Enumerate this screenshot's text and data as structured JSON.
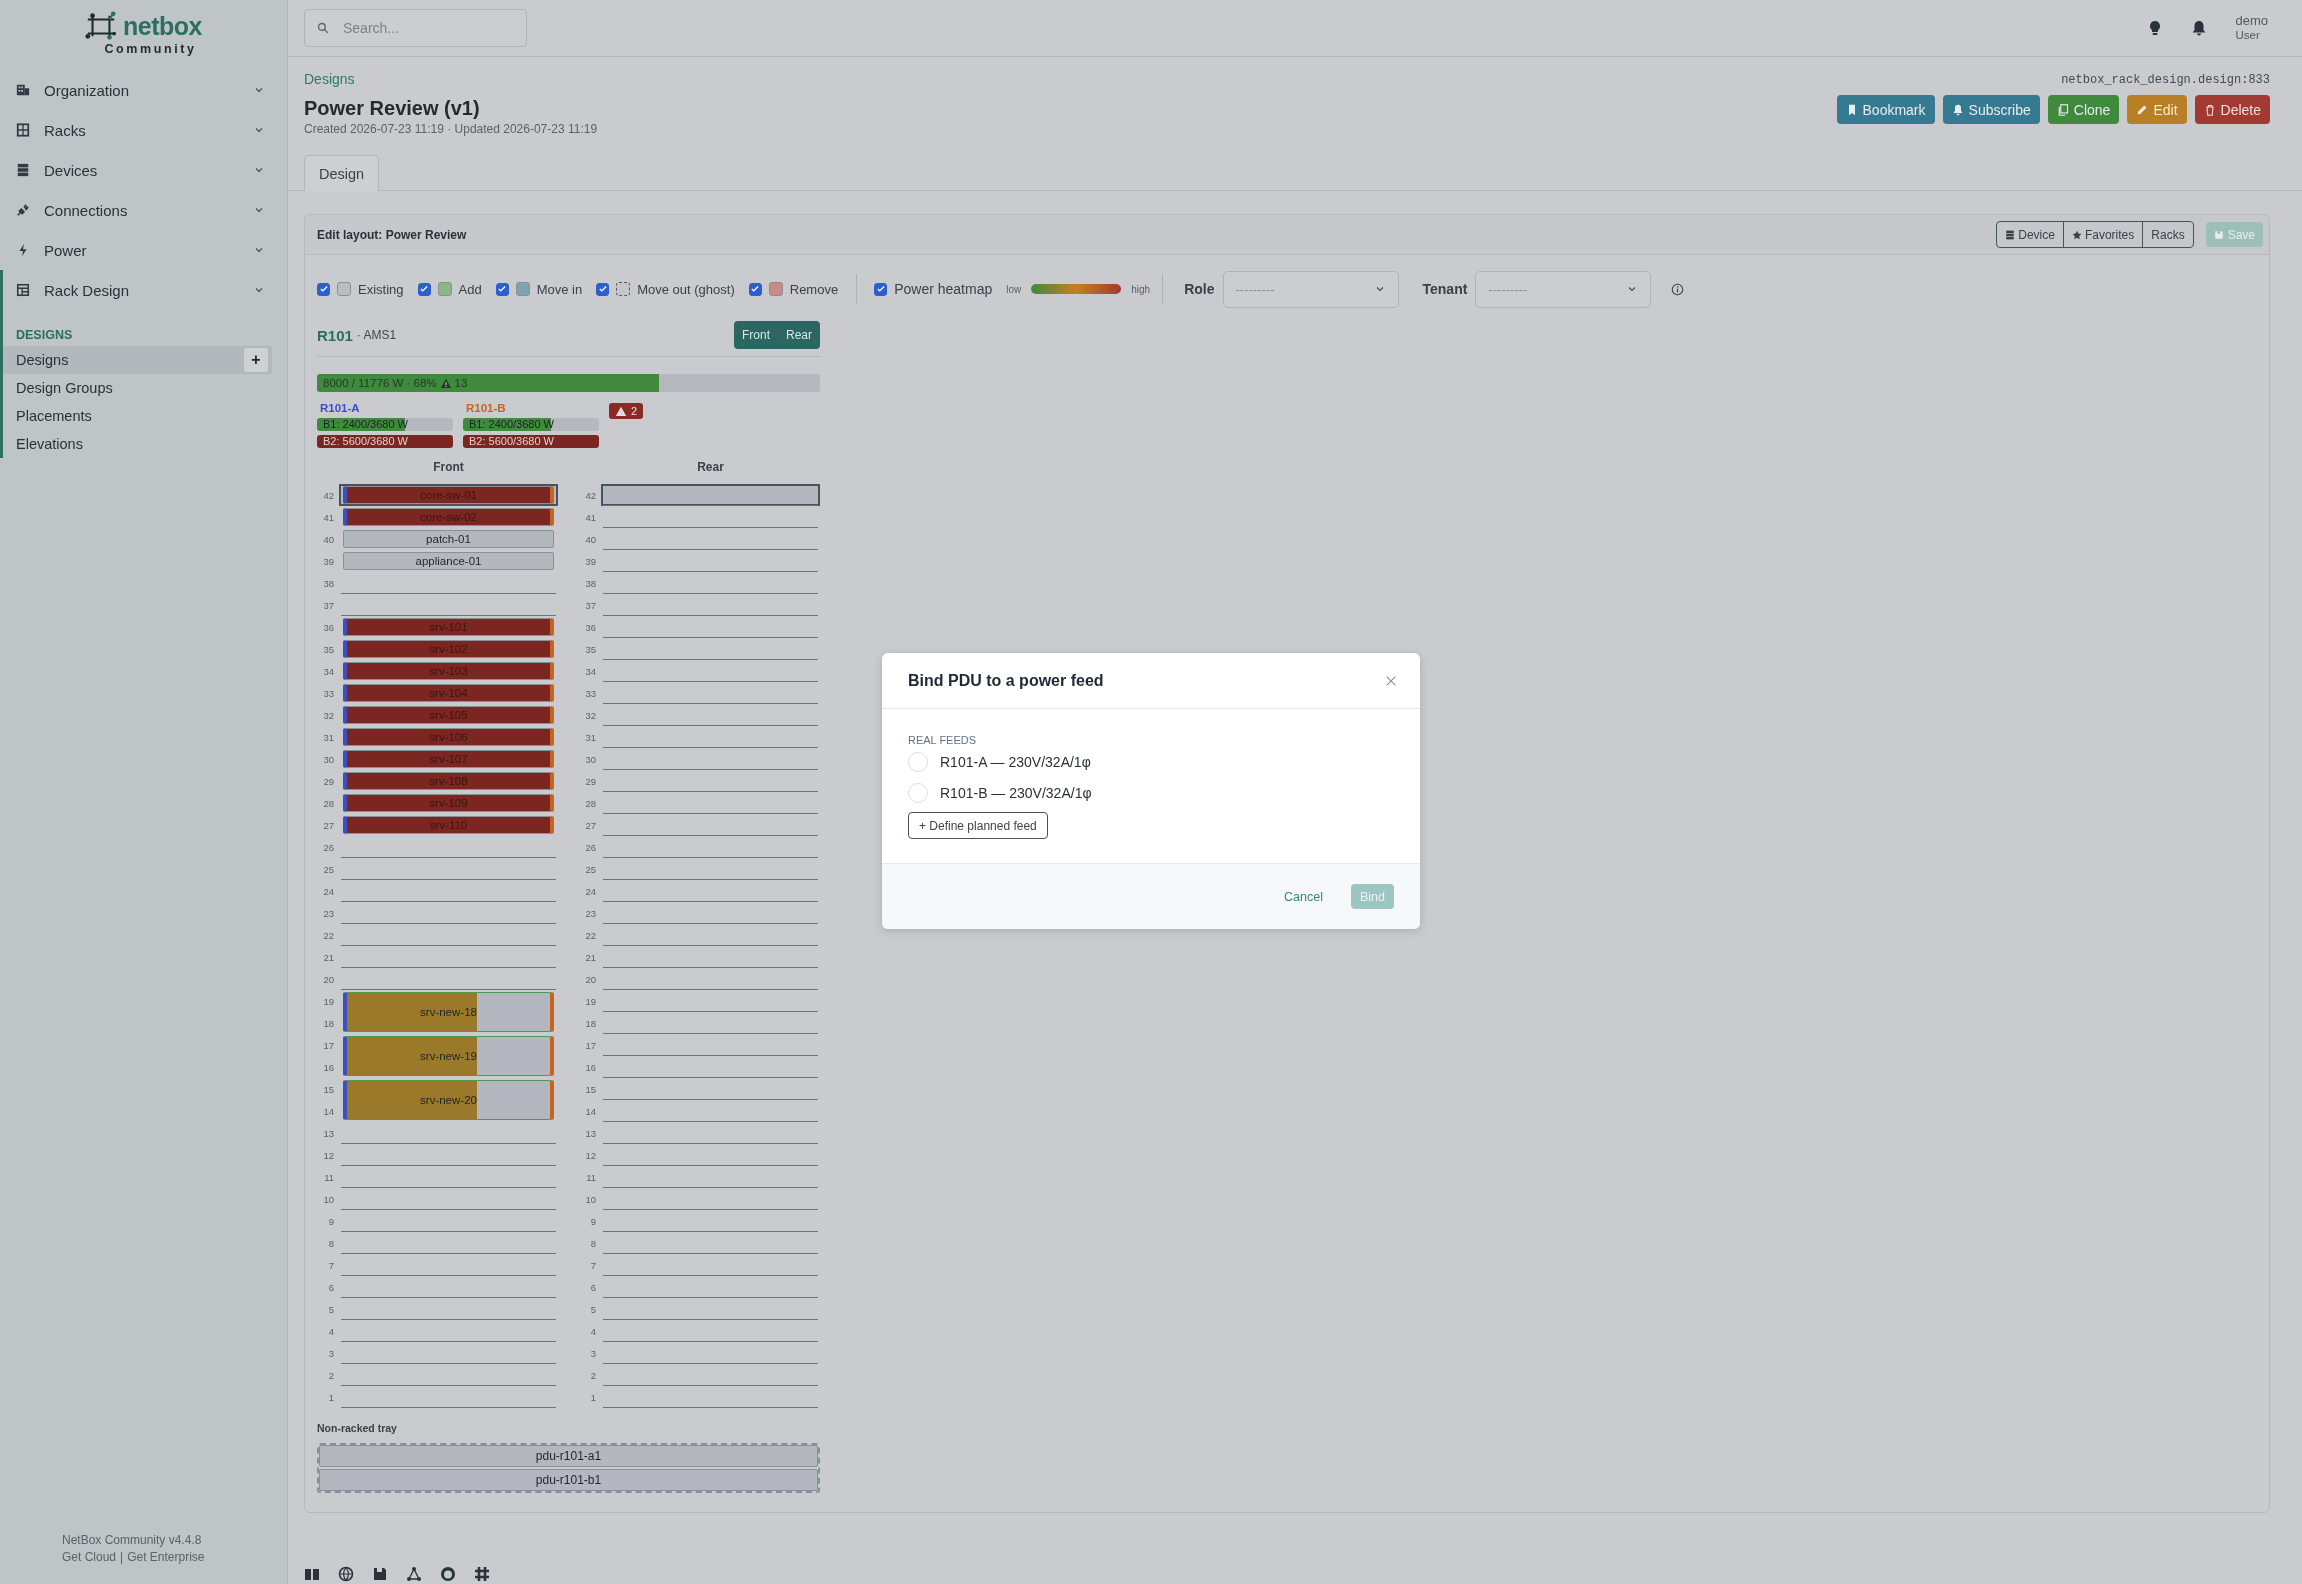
{
  "logo": {
    "name": "netbox",
    "edition": "Community"
  },
  "nav": {
    "items": [
      {
        "label": "Organization",
        "selected": false
      },
      {
        "label": "Racks",
        "selected": false
      },
      {
        "label": "Devices",
        "selected": false
      },
      {
        "label": "Connections",
        "selected": false
      },
      {
        "label": "Power",
        "selected": false
      },
      {
        "label": "Rack Design",
        "selected": true,
        "submenu": {
          "heading": "DESIGNS",
          "items": [
            {
              "label": "Designs",
              "selected": true,
              "add": "+"
            },
            {
              "label": "Design Groups",
              "selected": false
            },
            {
              "label": "Placements",
              "selected": false
            },
            {
              "label": "Elevations",
              "selected": false
            }
          ]
        }
      }
    ]
  },
  "sidebar_footer": {
    "version": "NetBox Community v4.4.8",
    "links": [
      "Get Cloud",
      "Get Enterprise"
    ],
    "separator": "|"
  },
  "topbar": {
    "search": {
      "placeholder": "Search..."
    },
    "user": {
      "name": "demo",
      "role": "User"
    }
  },
  "page": {
    "breadcrumb": "Designs",
    "title": "Power Review (v1)",
    "meta": "Created 2026-07-23 11:19 · Updated 2026-07-23 11:19",
    "object_id": "netbox_rack_design.design:833",
    "actions": [
      {
        "label": "Bookmark",
        "kind": "bookmark"
      },
      {
        "label": "Subscribe",
        "kind": "subscribe"
      },
      {
        "label": "Clone",
        "kind": "clone"
      },
      {
        "label": "Edit",
        "kind": "edit"
      },
      {
        "label": "Delete",
        "kind": "delete"
      }
    ],
    "tabs": [
      {
        "label": "Design",
        "selected": true
      }
    ]
  },
  "editor": {
    "title": "Edit layout: Power Review",
    "views": [
      {
        "label": "Device",
        "kind": "device"
      },
      {
        "label": "Favorites",
        "kind": "favorites"
      },
      {
        "label": "Racks",
        "kind": "racks"
      }
    ],
    "save": {
      "label": "Save",
      "disabled": true
    },
    "filters": [
      {
        "label": "Existing",
        "checked": true,
        "kind": "solid",
        "color": "#b9bcc2"
      },
      {
        "label": "Add",
        "checked": true,
        "kind": "solid",
        "color": "#8db585"
      },
      {
        "label": "Move in",
        "checked": true,
        "kind": "solid",
        "color": "#7ea4b0"
      },
      {
        "label": "Move out (ghost)",
        "checked": true,
        "kind": "dashed",
        "color": "#c4c6ca"
      },
      {
        "label": "Remove",
        "checked": true,
        "kind": "solid",
        "color": "#c98a86"
      }
    ],
    "heatmap": {
      "label": "Power heatmap",
      "checked": true,
      "low": "low",
      "high": "high"
    },
    "selects": [
      {
        "label": "Role",
        "value": "---------"
      },
      {
        "label": "Tenant",
        "value": "---------"
      }
    ],
    "rack": {
      "name": "R101",
      "site": "· AMS1",
      "faces": [
        "Front",
        "Rear"
      ],
      "power": {
        "text": "8000 / 11776 W · 68%",
        "warnings": "13",
        "level": 0.68
      },
      "feeds": [
        {
          "name": "R101-A",
          "color": "#3b4fc4",
          "bars": [
            {
              "label": "B1: 2400/3680 W",
              "level": 0.65,
              "color": "#3f8a3d"
            },
            {
              "label": "B2: 5600/3680 W",
              "level": 1,
              "color": "#7b2621"
            }
          ]
        },
        {
          "name": "R101-B",
          "color": "#c8641e",
          "bars": [
            {
              "label": "B1: 2400/3680 W",
              "level": 0.65,
              "color": "#3f8a3d"
            },
            {
              "label": "B2: 5600/3680 W",
              "level": 1,
              "color": "#7b2621"
            }
          ]
        }
      ],
      "alert": "2",
      "front": {
        "label": "Front",
        "slots": [
          {
            "kind": "device",
            "units": [
              "42"
            ],
            "name": "core-sw-01",
            "added": false,
            "color": "#7b2621",
            "feed_a": true,
            "feed_b": true
          },
          {
            "kind": "device",
            "units": [
              "41"
            ],
            "name": "core-sw-02",
            "added": false,
            "color": "#7b2621",
            "feed_a": true,
            "feed_b": true
          },
          {
            "kind": "device",
            "units": [
              "40"
            ],
            "name": "patch-01",
            "added": false,
            "color": "#b4b7be",
            "feed_a": false,
            "feed_b": false
          },
          {
            "kind": "device",
            "units": [
              "39"
            ],
            "name": "appliance-01",
            "added": false,
            "color": "#b4b7be",
            "feed_a": false,
            "feed_b": false
          },
          {
            "kind": "empty",
            "units": [
              "38"
            ]
          },
          {
            "kind": "empty",
            "units": [
              "37"
            ]
          },
          {
            "kind": "device",
            "units": [
              "36"
            ],
            "name": "srv-101",
            "added": false,
            "color": "#7b2621",
            "feed_a": true,
            "feed_b": true
          },
          {
            "kind": "device",
            "units": [
              "35"
            ],
            "name": "srv-102",
            "added": false,
            "color": "#7b2621",
            "feed_a": true,
            "feed_b": true
          },
          {
            "kind": "device",
            "units": [
              "34"
            ],
            "name": "srv-103",
            "added": false,
            "color": "#7b2621",
            "feed_a": true,
            "feed_b": true
          },
          {
            "kind": "device",
            "units": [
              "33"
            ],
            "name": "srv-104",
            "added": false,
            "color": "#7b2621",
            "feed_a": true,
            "feed_b": true
          },
          {
            "kind": "device",
            "units": [
              "32"
            ],
            "name": "srv-105",
            "added": false,
            "color": "#7b2621",
            "feed_a": true,
            "feed_b": true
          },
          {
            "kind": "device",
            "units": [
              "31"
            ],
            "name": "srv-106",
            "added": false,
            "color": "#7b2621",
            "feed_a": true,
            "feed_b": true
          },
          {
            "kind": "device",
            "units": [
              "30"
            ],
            "name": "srv-107",
            "added": false,
            "color": "#7b2621",
            "feed_a": true,
            "feed_b": true
          },
          {
            "kind": "device",
            "units": [
              "29"
            ],
            "name": "srv-108",
            "added": false,
            "color": "#7b2621",
            "feed_a": true,
            "feed_b": true
          },
          {
            "kind": "device",
            "units": [
              "28"
            ],
            "name": "srv-109",
            "added": false,
            "color": "#7b2621",
            "feed_a": true,
            "feed_b": true
          },
          {
            "kind": "device",
            "units": [
              "27"
            ],
            "name": "srv-110",
            "added": false,
            "color": "#7b2621",
            "feed_a": true,
            "feed_b": true
          },
          {
            "kind": "empty",
            "units": [
              "26"
            ]
          },
          {
            "kind": "empty",
            "units": [
              "25"
            ]
          },
          {
            "kind": "empty",
            "units": [
              "24"
            ]
          },
          {
            "kind": "empty",
            "units": [
              "23"
            ]
          },
          {
            "kind": "empty",
            "units": [
              "22"
            ]
          },
          {
            "kind": "empty",
            "units": [
              "21"
            ]
          },
          {
            "kind": "empty",
            "units": [
              "20"
            ]
          },
          {
            "kind": "device",
            "units": [
              "19",
              "18"
            ],
            "name": "srv-new-18",
            "added": true,
            "color": "#9a7a2a",
            "level": 0.64,
            "feed_a": true,
            "feed_b": true
          },
          {
            "kind": "device",
            "units": [
              "17",
              "16"
            ],
            "name": "srv-new-19",
            "added": true,
            "color": "#9a7a2a",
            "level": 0.64,
            "feed_a": true,
            "feed_b": true
          },
          {
            "kind": "device",
            "units": [
              "15",
              "14"
            ],
            "name": "srv-new-20",
            "added": true,
            "color": "#9a7a2a",
            "level": 0.64,
            "feed_a": true,
            "feed_b": true
          },
          {
            "kind": "empty",
            "units": [
              "13"
            ]
          },
          {
            "kind": "empty",
            "units": [
              "12"
            ]
          },
          {
            "kind": "empty",
            "units": [
              "11"
            ]
          },
          {
            "kind": "empty",
            "units": [
              "10"
            ]
          },
          {
            "kind": "empty",
            "units": [
              "9"
            ]
          },
          {
            "kind": "empty",
            "units": [
              "8"
            ]
          },
          {
            "kind": "empty",
            "units": [
              "7"
            ]
          },
          {
            "kind": "empty",
            "units": [
              "6"
            ]
          },
          {
            "kind": "empty",
            "units": [
              "5"
            ]
          },
          {
            "kind": "empty",
            "units": [
              "4"
            ]
          },
          {
            "kind": "empty",
            "units": [
              "3"
            ]
          },
          {
            "kind": "empty",
            "units": [
              "2"
            ]
          },
          {
            "kind": "empty",
            "units": [
              "1"
            ]
          }
        ]
      },
      "rear": {
        "label": "Rear",
        "units": [
          "42",
          "41",
          "40",
          "39",
          "38",
          "37",
          "36",
          "35",
          "34",
          "33",
          "32",
          "31",
          "30",
          "29",
          "28",
          "27",
          "26",
          "25",
          "24",
          "23",
          "22",
          "21",
          "20",
          "19",
          "18",
          "17",
          "16",
          "15",
          "14",
          "13",
          "12",
          "11",
          "10",
          "9",
          "8",
          "7",
          "6",
          "5",
          "4",
          "3",
          "2",
          "1"
        ]
      },
      "tray": {
        "label": "Non-racked tray",
        "items": [
          "pdu-r101-a1",
          "pdu-r101-b1"
        ]
      }
    }
  },
  "modal": {
    "title": "Bind PDU to a power feed",
    "section": "REAL FEEDS",
    "options": [
      {
        "label": "R101-A — 230V/32A/1φ",
        "selected": false
      },
      {
        "label": "R101-B — 230V/32A/1φ",
        "selected": false
      }
    ],
    "define": "+ Define planned feed",
    "cancel": "Cancel",
    "confirm": {
      "label": "Bind",
      "disabled": true
    }
  }
}
